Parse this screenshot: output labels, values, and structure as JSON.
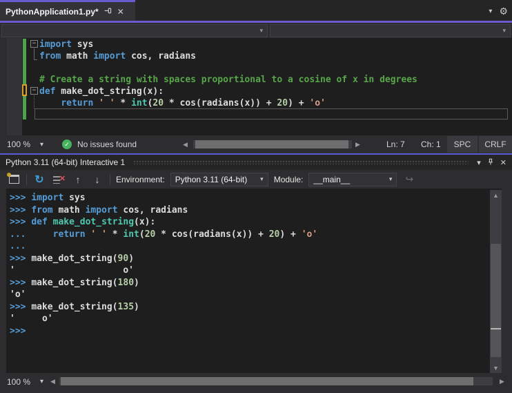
{
  "window_title": "Visual Studio - Python editor with Interactive window",
  "colors": {
    "accent_purple": "#6a5acf",
    "accent_blue_line": "#5b5bd6",
    "editor_bg": "#1e1e1e",
    "chrome_bg": "#2d2d30",
    "keyword": "#569cd6",
    "string": "#d69d85",
    "number": "#b5cea8",
    "comment": "#57a64a",
    "builtin": "#4ec9b0",
    "change_bar_green": "#4ea24e",
    "change_bar_orange": "#d8a22a",
    "check_green": "#47b360",
    "refresh_blue": "#3e9bd6",
    "clear_red": "#e05561"
  },
  "icons": {
    "chevron_down": "▾",
    "close": "✕",
    "gear": "⚙",
    "check": "✓",
    "refresh": "↻",
    "clear_x": "✕",
    "arrow_up": "↑",
    "arrow_down": "↓",
    "redo": "↪",
    "scroll_left": "◀",
    "scroll_right": "▶",
    "scroll_up": "▲",
    "scroll_down": "▼",
    "fold_collapse": "−"
  },
  "tab": {
    "title": "PythonApplication1.py*"
  },
  "navbar": {
    "left_dropdown_value": "",
    "right_dropdown_value": ""
  },
  "editor": {
    "lines": [
      [
        {
          "c": "kw",
          "t": "import"
        },
        {
          "c": "txt",
          "t": " sys"
        }
      ],
      [
        {
          "c": "kw",
          "t": "from"
        },
        {
          "c": "txt",
          "t": " math "
        },
        {
          "c": "kw",
          "t": "import"
        },
        {
          "c": "txt",
          "t": " cos, radians"
        }
      ],
      [],
      [
        {
          "c": "com",
          "t": "# Create a string with spaces proportional to a cosine of x in degrees"
        }
      ],
      [
        {
          "c": "kw",
          "t": "def"
        },
        {
          "c": "txt",
          "t": " make_dot_string(x):"
        }
      ],
      [
        {
          "c": "txt",
          "t": "    "
        },
        {
          "c": "kw",
          "t": "return"
        },
        {
          "c": "str",
          "t": " ' '"
        },
        {
          "c": "txt",
          "t": " * "
        },
        {
          "c": "fn",
          "t": "int"
        },
        {
          "c": "txt",
          "t": "("
        },
        {
          "c": "num",
          "t": "20"
        },
        {
          "c": "txt",
          "t": " * cos(radians(x)) + "
        },
        {
          "c": "num",
          "t": "20"
        },
        {
          "c": "txt",
          "t": ") + "
        },
        {
          "c": "str",
          "t": "'o'"
        }
      ],
      []
    ],
    "status": {
      "zoom": "100 %",
      "health": "No issues found",
      "line": "Ln: 7",
      "column": "Ch: 1",
      "spaces": "SPC",
      "line_endings": "CRLF"
    }
  },
  "interactive": {
    "title": "Python 3.11 (64-bit) Interactive 1",
    "toolbar": {
      "environment_label": "Environment:",
      "environment_value": "Python 3.11 (64-bit)",
      "module_label": "Module:",
      "module_value": "__main__"
    },
    "lines": [
      [
        {
          "c": "prompt",
          "t": ">>> "
        },
        {
          "c": "kw",
          "t": "import"
        },
        {
          "c": "txt",
          "t": " sys"
        }
      ],
      [
        {
          "c": "prompt",
          "t": ">>> "
        },
        {
          "c": "kw",
          "t": "from"
        },
        {
          "c": "txt",
          "t": " math "
        },
        {
          "c": "kw",
          "t": "import"
        },
        {
          "c": "txt",
          "t": " cos, radians"
        }
      ],
      [
        {
          "c": "prompt",
          "t": ">>> "
        },
        {
          "c": "kw",
          "t": "def"
        },
        {
          "c": "txt",
          "t": " "
        },
        {
          "c": "fn",
          "t": "make_dot_string"
        },
        {
          "c": "txt",
          "t": "(x):"
        }
      ],
      [
        {
          "c": "prompt",
          "t": "... "
        },
        {
          "c": "txt",
          "t": "    "
        },
        {
          "c": "kw",
          "t": "return"
        },
        {
          "c": "str",
          "t": " ' '"
        },
        {
          "c": "txt",
          "t": " * "
        },
        {
          "c": "fn",
          "t": "int"
        },
        {
          "c": "txt",
          "t": "("
        },
        {
          "c": "num",
          "t": "20"
        },
        {
          "c": "txt",
          "t": " * cos(radians(x)) + "
        },
        {
          "c": "num",
          "t": "20"
        },
        {
          "c": "txt",
          "t": ") + "
        },
        {
          "c": "str",
          "t": "'o'"
        }
      ],
      [
        {
          "c": "prompt",
          "t": "..."
        }
      ],
      [
        {
          "c": "prompt",
          "t": ">>> "
        },
        {
          "c": "txt",
          "t": "make_dot_string("
        },
        {
          "c": "num",
          "t": "90"
        },
        {
          "c": "txt",
          "t": ")"
        }
      ],
      [
        {
          "c": "txt",
          "t": "'                    o'"
        }
      ],
      [
        {
          "c": "prompt",
          "t": ">>> "
        },
        {
          "c": "txt",
          "t": "make_dot_string("
        },
        {
          "c": "num",
          "t": "180"
        },
        {
          "c": "txt",
          "t": ")"
        }
      ],
      [
        {
          "c": "txt",
          "t": "'o'"
        }
      ],
      [
        {
          "c": "prompt",
          "t": ">>> "
        },
        {
          "c": "txt",
          "t": "make_dot_string("
        },
        {
          "c": "num",
          "t": "135"
        },
        {
          "c": "txt",
          "t": ")"
        }
      ],
      [
        {
          "c": "txt",
          "t": "'     o'"
        }
      ],
      [
        {
          "c": "prompt",
          "t": ">>>"
        }
      ]
    ],
    "status": {
      "zoom": "100 %"
    }
  }
}
